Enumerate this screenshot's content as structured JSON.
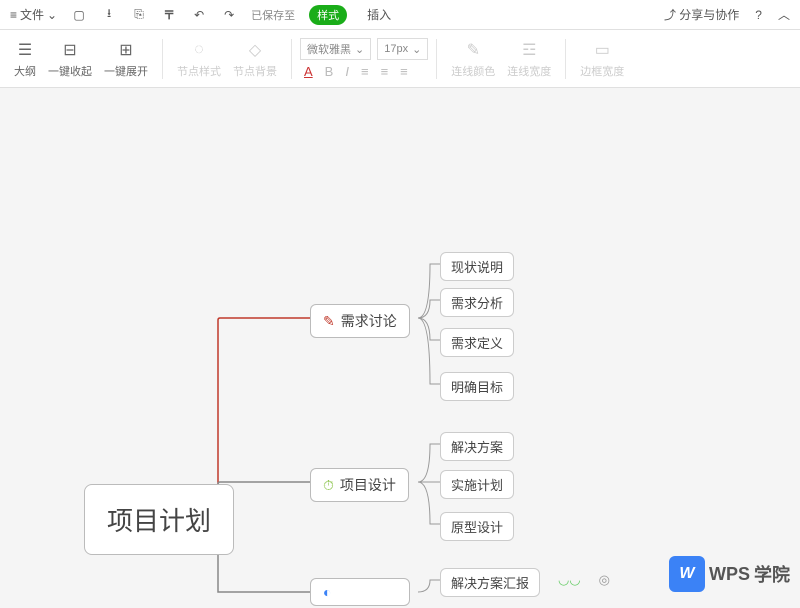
{
  "top": {
    "file": "文件",
    "saved": "已保存至",
    "pill": "样式",
    "insert": "插入",
    "share": "分享与协作",
    "help": "?"
  },
  "toolbar": {
    "outline": "大纲",
    "collapse": "一键收起",
    "expand": "一键展开",
    "nodeStyle": "节点样式",
    "nodeBg": "节点背景",
    "font": "微软雅黑",
    "size": "17px",
    "lineColor": "连线颜色",
    "lineWidth": "连线宽度",
    "borderWidth": "边框宽度"
  },
  "mindmap": {
    "root": "项目计划",
    "branch1": {
      "title": "需求讨论",
      "children": [
        "现状说明",
        "需求分析",
        "需求定义",
        "明确目标"
      ]
    },
    "branch2": {
      "title": "项目设计",
      "children": [
        "解决方案",
        "实施计划",
        "原型设计"
      ]
    },
    "branch3": {
      "title": "",
      "children": [
        "解决方案汇报"
      ]
    }
  },
  "watermark": {
    "wps": "WPS",
    "text": "学院"
  }
}
